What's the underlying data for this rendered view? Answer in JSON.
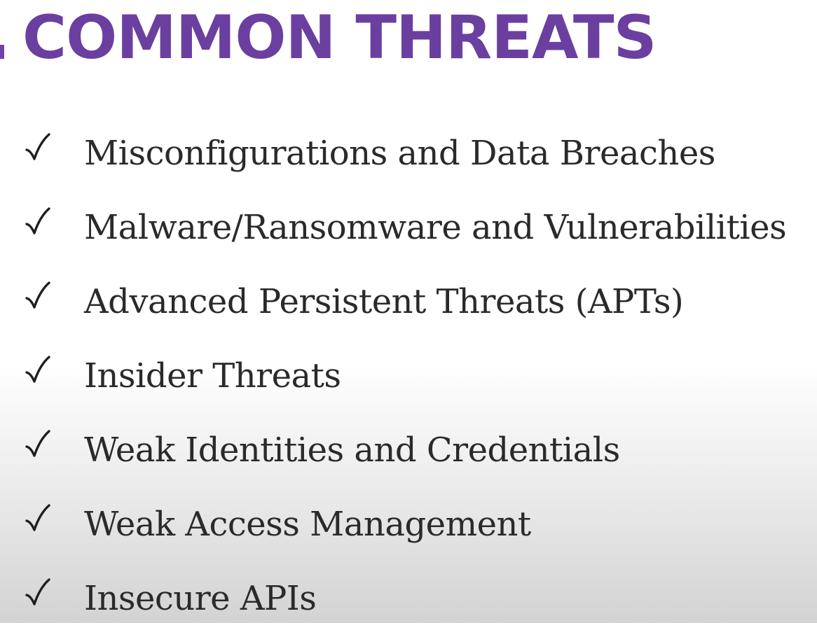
{
  "slide": {
    "title": "COMMON THREATS",
    "title_color": "#6b3fa0",
    "items": [
      {
        "label": "Misconfigurations and Data Breaches",
        "icon": "check-icon"
      },
      {
        "label": "Malware/Ransomware and Vulnerabilities",
        "icon": "check-icon"
      },
      {
        "label": "Advanced Persistent Threats (APTs)",
        "icon": "check-icon"
      },
      {
        "label": "Insider Threats",
        "icon": "check-icon"
      },
      {
        "label": "Weak Identities and Credentials",
        "icon": "check-icon"
      },
      {
        "label": "Weak Access Management",
        "icon": "check-icon"
      },
      {
        "label": "Insecure APIs",
        "icon": "check-icon"
      }
    ]
  }
}
